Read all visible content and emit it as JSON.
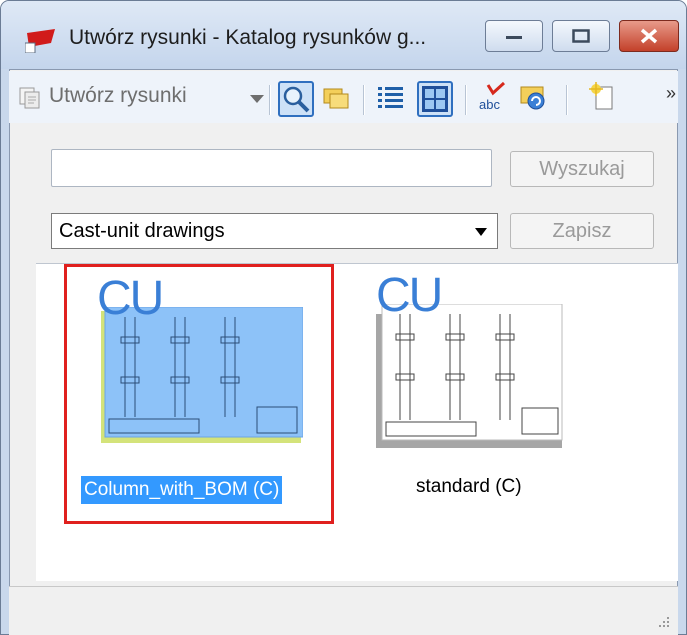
{
  "window": {
    "title": "Utwórz rysunki - Katalog rysunków g...",
    "controls": {
      "minimize": "minimize",
      "maximize": "maximize",
      "close": "close"
    }
  },
  "toolbar": {
    "create_label": "Utwórz rysunki",
    "overflow": "»",
    "icons": [
      "create-drawings-icon",
      "search-icon",
      "folder-copy-icon",
      "list-view-icon",
      "thumbnail-view-icon",
      "spellcheck-icon",
      "refresh-icon",
      "new-file-icon"
    ]
  },
  "search": {
    "value": "",
    "button_label": "Wyszukaj"
  },
  "filter": {
    "selected": "Cast-unit drawings",
    "save_label": "Zapisz"
  },
  "items": [
    {
      "badge": "CU",
      "label": "Column_with_BOM (C)",
      "selected": true
    },
    {
      "badge": "CU",
      "label": "standard (C)",
      "selected": false
    }
  ],
  "colors": {
    "selection": "#3399ff",
    "highlight_frame": "#e0201e",
    "badge": "#3a7fd6"
  }
}
